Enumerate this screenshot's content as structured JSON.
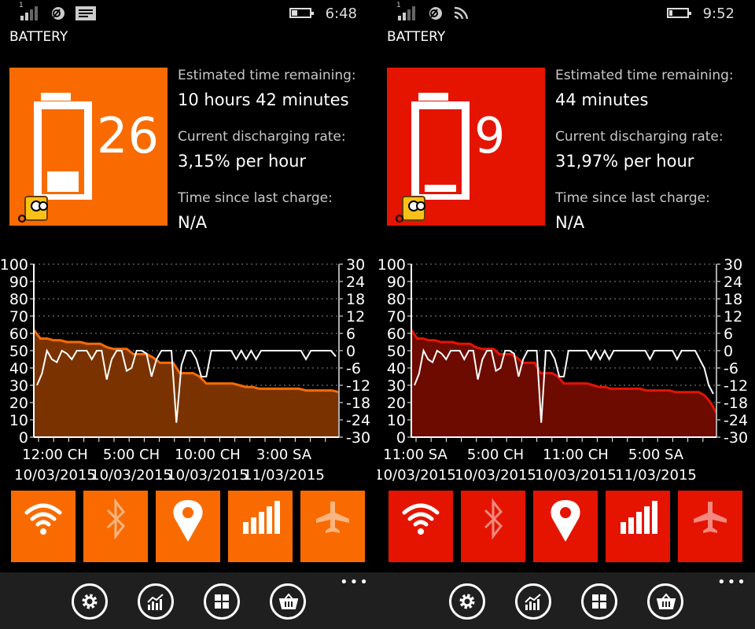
{
  "panels": [
    {
      "status": {
        "time": "6:48",
        "signal_label": "1",
        "battery_level": 0.3,
        "icons": [
          "signal-icon",
          "sync-icon",
          "message-icon",
          "battery-icon"
        ]
      },
      "title": "BATTERY",
      "accent": "#f96b00",
      "chart_fill": "#7a3300",
      "battery_percent": "26",
      "battery_fill": 0.26,
      "stats": [
        {
          "label": "Estimated time remaining:",
          "value": "10 hours 42 minutes"
        },
        {
          "label": "Current discharging rate:",
          "value": "3,15% per hour"
        },
        {
          "label": "Time since last charge:",
          "value": "N/A"
        }
      ],
      "toggles": [
        {
          "icon": "wifi-icon",
          "state": "on"
        },
        {
          "icon": "bluetooth-icon",
          "state": "off"
        },
        {
          "icon": "location-icon",
          "state": "on"
        },
        {
          "icon": "cellular-icon",
          "state": "on"
        },
        {
          "icon": "airplane-icon",
          "state": "off"
        }
      ],
      "appbar": {
        "buttons": [
          "settings-icon",
          "chart-icon",
          "tiles-icon",
          "basket-icon"
        ],
        "more": "•••"
      }
    },
    {
      "status": {
        "time": "9:52",
        "signal_label": "1",
        "battery_level": 0.15,
        "icons": [
          "signal-icon",
          "sync-icon",
          "wifi-icon",
          "battery-icon"
        ]
      },
      "title": "BATTERY",
      "accent": "#e51400",
      "chart_fill": "#6e0b00",
      "battery_percent": "9",
      "battery_fill": 0.09,
      "stats": [
        {
          "label": "Estimated time remaining:",
          "value": "44 minutes"
        },
        {
          "label": "Current discharging rate:",
          "value": "31,97% per hour"
        },
        {
          "label": "Time since last charge:",
          "value": "N/A"
        }
      ],
      "toggles": [
        {
          "icon": "wifi-icon",
          "state": "on"
        },
        {
          "icon": "bluetooth-icon",
          "state": "off"
        },
        {
          "icon": "location-icon",
          "state": "on"
        },
        {
          "icon": "cellular-icon",
          "state": "on"
        },
        {
          "icon": "airplane-icon",
          "state": "off"
        }
      ],
      "appbar": {
        "buttons": [
          "settings-icon",
          "chart-icon",
          "tiles-icon",
          "basket-icon"
        ],
        "more": "•••"
      }
    }
  ],
  "chart_data": [
    {
      "type": "area",
      "left_axis": {
        "range": [
          0,
          100
        ],
        "ticks": [
          "100",
          "90",
          "80",
          "70",
          "60",
          "50",
          "40",
          "30",
          "20",
          "10",
          "0"
        ]
      },
      "right_axis": {
        "range": [
          -30,
          30
        ],
        "ticks": [
          "30",
          "24",
          "18",
          "12",
          "6",
          "0",
          "-6",
          "-12",
          "-18",
          "-24",
          "-30"
        ]
      },
      "grid": true,
      "x_ticks": [
        {
          "time": "12:00 CH",
          "date": "10/03/2015"
        },
        {
          "time": "5:00 CH",
          "date": "10/03/2015"
        },
        {
          "time": "10:00 CH",
          "date": "10/03/2015"
        },
        {
          "time": "3:00 SA",
          "date": "11/03/2015"
        }
      ],
      "battery_series": [
        62,
        57,
        57,
        56,
        56,
        55,
        55,
        55,
        54,
        54,
        54,
        52,
        51,
        51,
        51,
        48,
        48,
        48,
        46,
        43,
        43,
        43,
        37,
        37,
        37,
        35,
        31,
        31,
        31,
        31,
        31,
        30,
        29,
        29,
        28,
        28,
        28,
        28,
        28,
        28,
        28,
        27,
        27,
        27,
        27,
        27,
        26
      ],
      "rate_series": [
        -12,
        -8,
        0,
        -3,
        -4,
        0,
        -1,
        -3,
        0,
        0,
        0,
        -3,
        0,
        0,
        -10,
        -3,
        0,
        0,
        -7,
        -6,
        0,
        0,
        -1,
        -9,
        -3,
        0,
        0,
        0,
        -25,
        -5,
        0,
        0,
        -3,
        -9,
        -9,
        0,
        0,
        0,
        0,
        0,
        -3,
        0,
        -3,
        0,
        -3,
        0,
        0,
        0,
        0,
        0,
        0,
        0,
        0,
        0,
        -3,
        0,
        0,
        0,
        0,
        0,
        -2
      ]
    },
    {
      "type": "area",
      "left_axis": {
        "range": [
          0,
          100
        ],
        "ticks": [
          "100",
          "90",
          "80",
          "70",
          "60",
          "50",
          "40",
          "30",
          "20",
          "10",
          "0"
        ]
      },
      "right_axis": {
        "range": [
          -30,
          30
        ],
        "ticks": [
          "30",
          "24",
          "18",
          "12",
          "6",
          "0",
          "-6",
          "-12",
          "-18",
          "-24",
          "-30"
        ]
      },
      "grid": true,
      "x_ticks": [
        {
          "time": "11:00 SA",
          "date": "10/03/2015"
        },
        {
          "time": "5:00 CH",
          "date": "10/03/2015"
        },
        {
          "time": "11:00 CH",
          "date": "10/03/2015"
        },
        {
          "time": "5:00 SA",
          "date": "11/03/2015"
        }
      ],
      "battery_series": [
        62,
        57,
        57,
        56,
        56,
        55,
        55,
        55,
        54,
        54,
        54,
        52,
        51,
        51,
        51,
        48,
        48,
        48,
        46,
        43,
        43,
        43,
        37,
        37,
        37,
        35,
        31,
        31,
        31,
        31,
        31,
        30,
        29,
        29,
        28,
        28,
        28,
        28,
        28,
        28,
        27,
        27,
        27,
        27,
        27,
        26,
        26,
        26,
        26,
        26,
        24,
        20,
        14
      ],
      "rate_series": [
        -12,
        -8,
        0,
        -3,
        -4,
        0,
        -1,
        -3,
        0,
        0,
        0,
        -3,
        0,
        0,
        -10,
        -3,
        0,
        0,
        -7,
        -6,
        0,
        0,
        -1,
        -9,
        -3,
        0,
        0,
        0,
        -25,
        0,
        0,
        -3,
        -9,
        -9,
        0,
        0,
        0,
        0,
        0,
        -3,
        0,
        -3,
        0,
        -3,
        0,
        0,
        0,
        0,
        0,
        0,
        0,
        0,
        -3,
        0,
        0,
        0,
        0,
        0,
        -3,
        0,
        0,
        0,
        0,
        -3,
        -6,
        -12,
        -15
      ]
    }
  ]
}
